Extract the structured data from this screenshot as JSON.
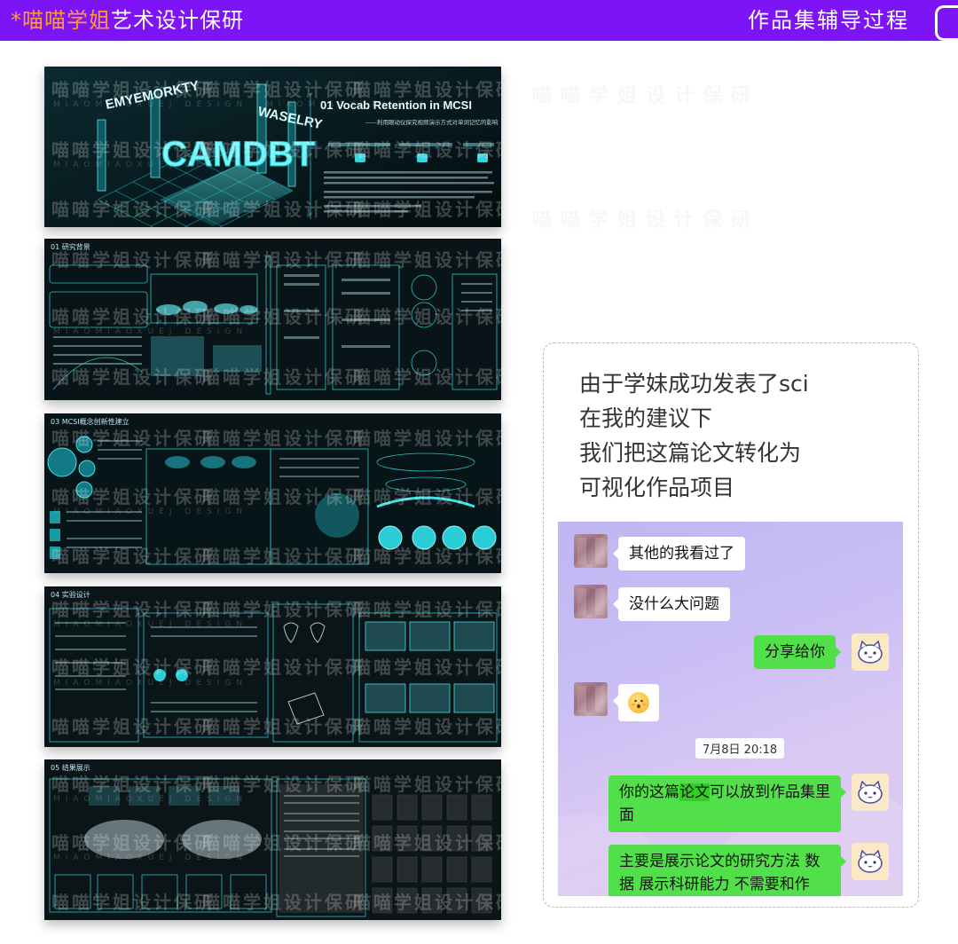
{
  "header": {
    "brand_highlight": "*喵喵学姐",
    "brand_rest": "艺术设计保研",
    "page_heading": "作品集辅导过程"
  },
  "watermark": {
    "cn": "喵喵学姐设计保研",
    "en": "MIAOMIAOXUEJ DESIGN"
  },
  "panels": [
    {
      "name": "cover",
      "title": "01 Vocab Retention in MCSI",
      "subtitle": "——利用眼动仪探究视频演示方式对单词记忆的影响",
      "sign_words": [
        "EMYEMORKTY",
        "WASELRY",
        "CAMDBT"
      ]
    },
    {
      "name": "research-background",
      "title": "01 研究背景"
    },
    {
      "name": "mcsi-model",
      "title": "03 MCSI概念创新性建立"
    },
    {
      "name": "experiment-design",
      "title": "04 实验设计"
    },
    {
      "name": "results",
      "title": "05 结果展示"
    }
  ],
  "card": {
    "lines": [
      "由于学妹成功发表了sci",
      "在我的建议下",
      "我们把这篇论文转化为",
      "可视化作品项目"
    ]
  },
  "chat": {
    "messages": [
      {
        "side": "left",
        "text": "其他的我看过了"
      },
      {
        "side": "left",
        "text": "没什么大问题"
      },
      {
        "side": "right",
        "text": "分享给你"
      },
      {
        "side": "left",
        "text": "",
        "emoji": "blushing-face"
      },
      {
        "side": "right",
        "text_before": "你的这篇",
        "text_highlight": "论文",
        "text_after": "可以放到作品集里面"
      },
      {
        "side": "right",
        "text": "主要是展示论文的研究方法 数据 展示科研能力 不需要和作"
      }
    ],
    "timestamp": "7月8日 20:18"
  }
}
